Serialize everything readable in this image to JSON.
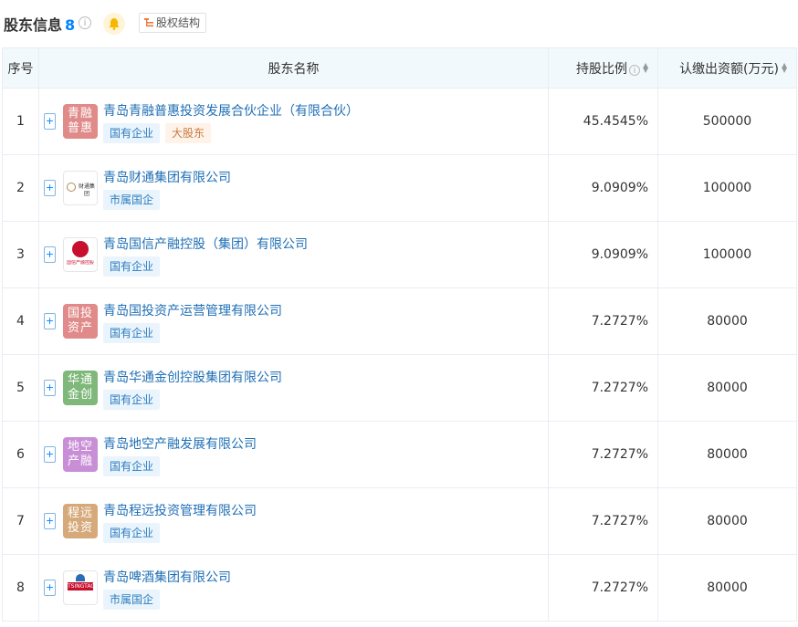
{
  "header": {
    "title": "股东信息",
    "count": "8",
    "info_icon": "i",
    "struct_label": "股权结构"
  },
  "columns": {
    "idx": "序号",
    "name": "股东名称",
    "ratio": "持股比例",
    "amount": "认缴出资额(万元)"
  },
  "rows": [
    {
      "idx": "1",
      "name": "青岛青融普惠投资发展合伙企业（有限合伙）",
      "logo_text": "青融普惠",
      "logo_color": "#e08a8a",
      "tags": [
        "国有企业",
        "大股东"
      ],
      "ratio": "45.4545%",
      "amount": "500000"
    },
    {
      "idx": "2",
      "name": "青岛财通集团有限公司",
      "logo_text": "财通集团",
      "logo_color": "#ffffff",
      "tags": [
        "市属国企"
      ],
      "ratio": "9.0909%",
      "amount": "100000"
    },
    {
      "idx": "3",
      "name": "青岛国信产融控股（集团）有限公司",
      "logo_text": "国信产融控股",
      "logo_color": "#ffffff",
      "tags": [
        "国有企业"
      ],
      "ratio": "9.0909%",
      "amount": "100000"
    },
    {
      "idx": "4",
      "name": "青岛国投资产运营管理有限公司",
      "logo_text": "国投资产",
      "logo_color": "#e08a8a",
      "tags": [
        "国有企业"
      ],
      "ratio": "7.2727%",
      "amount": "80000"
    },
    {
      "idx": "5",
      "name": "青岛华通金创控股集团有限公司",
      "logo_text": "华通金创",
      "logo_color": "#7fb87a",
      "tags": [
        "国有企业"
      ],
      "ratio": "7.2727%",
      "amount": "80000"
    },
    {
      "idx": "6",
      "name": "青岛地空产融发展有限公司",
      "logo_text": "地空产融",
      "logo_color": "#c98fd6",
      "tags": [
        "国有企业"
      ],
      "ratio": "7.2727%",
      "amount": "80000"
    },
    {
      "idx": "7",
      "name": "青岛程远投资管理有限公司",
      "logo_text": "程远投资",
      "logo_color": "#d6a97a",
      "tags": [
        "国有企业"
      ],
      "ratio": "7.2727%",
      "amount": "80000"
    },
    {
      "idx": "8",
      "name": "青岛啤酒集团有限公司",
      "logo_text": "TSINGTAO",
      "logo_color": "#ffffff",
      "tags": [
        "市属国企"
      ],
      "ratio": "7.2727%",
      "amount": "80000"
    }
  ],
  "colors": {
    "accent": "#0084ff",
    "link": "#1f6fb5",
    "header_bg": "#f2f9fc"
  }
}
